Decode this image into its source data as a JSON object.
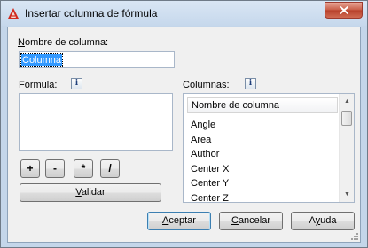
{
  "window": {
    "title": "Insertar columna de fórmula",
    "icon": "autocad-red-triangle-icon",
    "close_icon": "x-close-icon"
  },
  "name_field": {
    "label_underlined": "N",
    "label_rest": "ombre de columna:",
    "value": "Columna"
  },
  "formula": {
    "label_underlined": "F",
    "label_rest": "órmula:",
    "value": "",
    "info_icon": "info-icon"
  },
  "operators": [
    "+",
    "-",
    "*",
    "/"
  ],
  "validate_button": {
    "underlined": "V",
    "rest": "alidar"
  },
  "columns": {
    "label_underlined": "C",
    "label_rest": "olumnas:",
    "info_icon": "info-icon",
    "header": "Nombre de columna",
    "items": [
      "Angle",
      "Area",
      "Author",
      "Center X",
      "Center Y",
      "Center Z"
    ]
  },
  "buttons": {
    "ok": {
      "underlined": "A",
      "rest": "ceptar"
    },
    "cancel": {
      "underlined": "C",
      "rest": "ancelar"
    },
    "help": {
      "underlined": "y",
      "before": "A",
      "rest": "uda"
    }
  },
  "colors": {
    "title_bg": "#c6d8ec",
    "close_red": "#c75a44",
    "selection": "#3399ff",
    "dialog_bg": "#f0f0f0"
  }
}
